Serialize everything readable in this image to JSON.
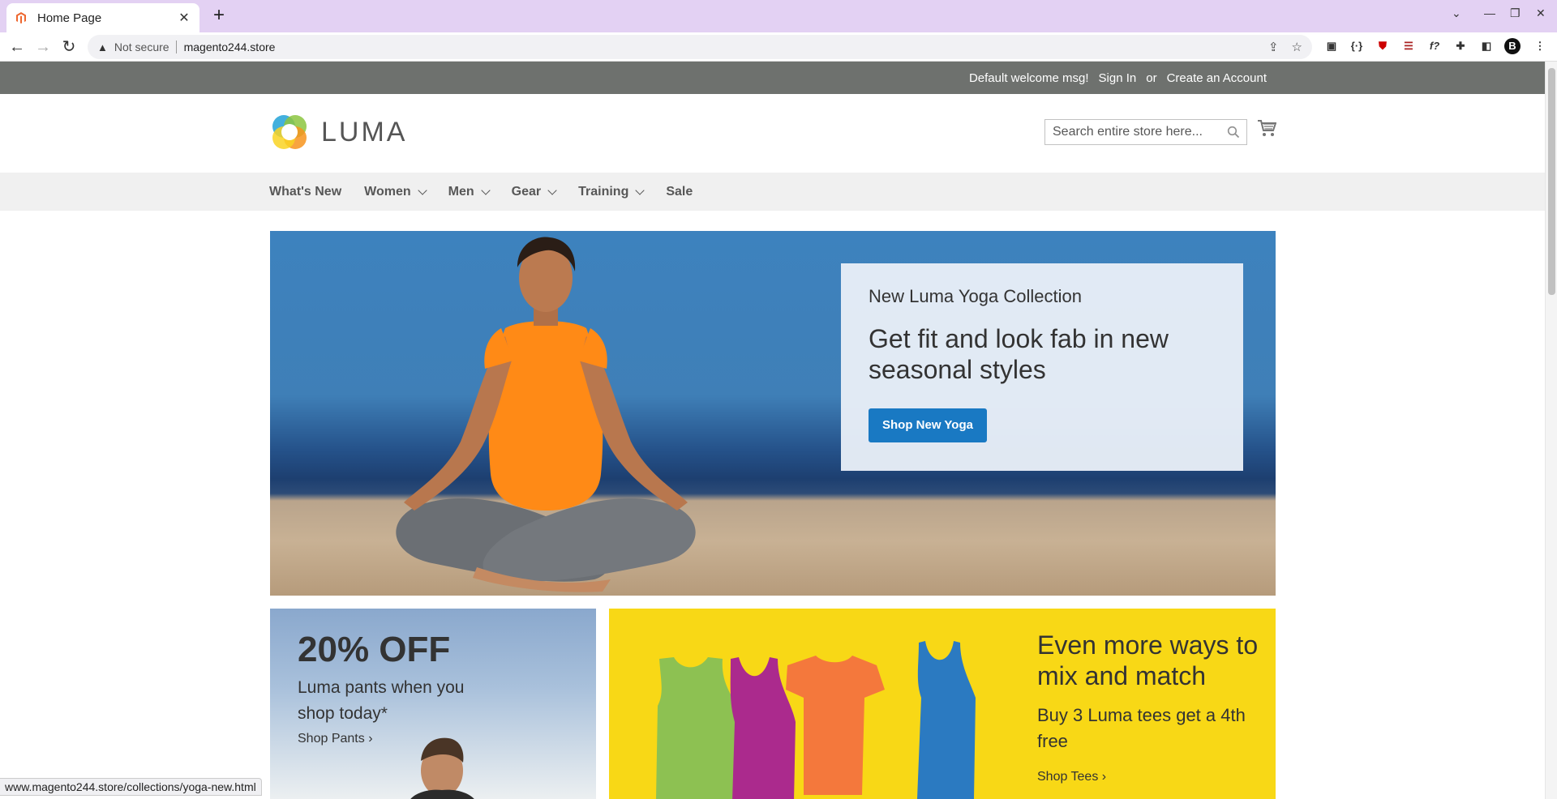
{
  "browser": {
    "tab_title": "Home Page",
    "address_not_secure": "Not secure",
    "address_url": "magento244.store"
  },
  "topbar": {
    "welcome": "Default welcome msg!",
    "sign_in": "Sign In",
    "or": "or",
    "create_account": "Create an Account"
  },
  "header": {
    "logo_text": "LUMA",
    "search_placeholder": "Search entire store here..."
  },
  "nav": {
    "items": [
      {
        "label": "What's New",
        "has_submenu": false
      },
      {
        "label": "Women",
        "has_submenu": true
      },
      {
        "label": "Men",
        "has_submenu": true
      },
      {
        "label": "Gear",
        "has_submenu": true
      },
      {
        "label": "Training",
        "has_submenu": true
      },
      {
        "label": "Sale",
        "has_submenu": false
      }
    ]
  },
  "hero": {
    "subtitle": "New Luma Yoga Collection",
    "headline": "Get fit and look fab in new seasonal styles",
    "button": "Shop New Yoga"
  },
  "promo_pants": {
    "big": "20% OFF",
    "desc": "Luma pants when you shop today*",
    "link": "Shop Pants"
  },
  "promo_tees": {
    "title": "Even more ways to mix and match",
    "desc": "Buy 3 Luma tees get a 4th free",
    "link": "Shop Tees"
  },
  "statusbar": {
    "url": "www.magento244.store/collections/yoga-new.html"
  },
  "colors": {
    "accent": "#1979c3",
    "topbar": "#6e716e",
    "nav_bg": "#f0f0f0",
    "promo_yellow": "#f8d816"
  }
}
